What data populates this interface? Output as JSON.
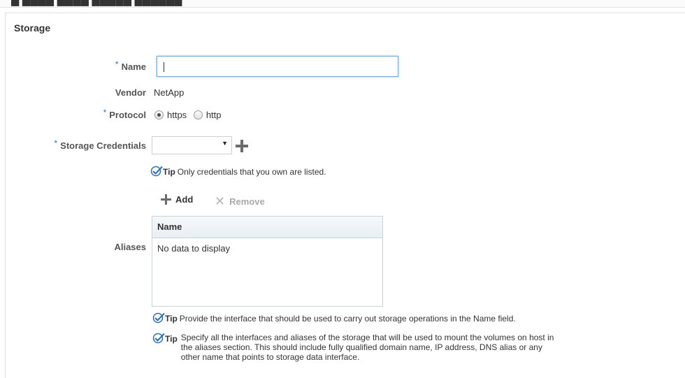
{
  "page": {
    "section_title": "Storage"
  },
  "form": {
    "name": {
      "label": "Name",
      "value": "",
      "required": true
    },
    "vendor": {
      "label": "Vendor",
      "value": "NetApp"
    },
    "protocol": {
      "label": "Protocol",
      "required": true,
      "options": [
        {
          "label": "https",
          "selected": true
        },
        {
          "label": "http",
          "selected": false
        }
      ]
    },
    "credentials": {
      "label": "Storage Credentials",
      "required": true,
      "selected_value": "",
      "add_icon": "plus-icon",
      "tip_label": "Tip",
      "tip_text": "Only credentials that you own are listed."
    },
    "aliases": {
      "label": "Aliases",
      "toolbar": {
        "add_label": "Add",
        "add_icon": "plus-icon",
        "remove_label": "Remove",
        "remove_icon": "x-icon",
        "remove_disabled": true
      },
      "table": {
        "columns": [
          "Name"
        ],
        "rows": [],
        "empty_text": "No data to display"
      }
    },
    "tips": [
      {
        "label": "Tip",
        "text": "Provide the interface that should be used to carry out storage operations in the Name field."
      },
      {
        "label": "Tip",
        "text_lines": [
          "Specify all the interfaces and aliases of the storage that will be used to mount the volumes on host in",
          "the aliases section. This should include fully qualified domain name, IP address, DNS alias or any",
          "other name that points to storage data interface."
        ]
      }
    ]
  },
  "colors": {
    "required_asterisk": "#3071b5",
    "focus_border": "#75a9d9",
    "tip_check": "#2f6db3"
  }
}
